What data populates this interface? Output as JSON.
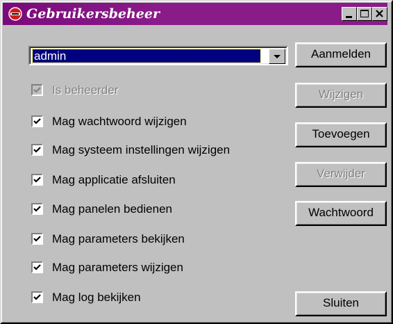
{
  "window": {
    "title": "Gebruikersbeheer",
    "icon": "red-circle-app-icon",
    "accent_color": "#7a0a7a"
  },
  "titlebar_buttons": [
    {
      "name": "minimize-button",
      "icon": "minimize-icon"
    },
    {
      "name": "maximize-button",
      "icon": "maximize-icon"
    },
    {
      "name": "close-button",
      "icon": "close-icon"
    }
  ],
  "user_select": {
    "value": "admin"
  },
  "permissions": [
    {
      "label": "Is beheerder",
      "checked": true,
      "disabled": true
    },
    {
      "label": "Mag wachtwoord wijzigen",
      "checked": true,
      "disabled": false
    },
    {
      "label": "Mag systeem instellingen wijzigen",
      "checked": true,
      "disabled": false
    },
    {
      "label": "Mag applicatie afsluiten",
      "checked": true,
      "disabled": false
    },
    {
      "label": "Mag panelen bedienen",
      "checked": true,
      "disabled": false
    },
    {
      "label": "Mag parameters bekijken",
      "checked": true,
      "disabled": false
    },
    {
      "label": "Mag parameters wijzigen",
      "checked": true,
      "disabled": false
    },
    {
      "label": "Mag log bekijken",
      "checked": true,
      "disabled": false
    }
  ],
  "buttons": {
    "login": {
      "label": "Aanmelden",
      "disabled": false
    },
    "edit": {
      "label": "Wijzigen",
      "disabled": true
    },
    "add": {
      "label": "Toevoegen",
      "disabled": false
    },
    "remove": {
      "label": "Verwijder",
      "disabled": true
    },
    "password": {
      "label": "Wachtwoord",
      "disabled": false
    },
    "close": {
      "label": "Sluiten",
      "disabled": false
    }
  }
}
